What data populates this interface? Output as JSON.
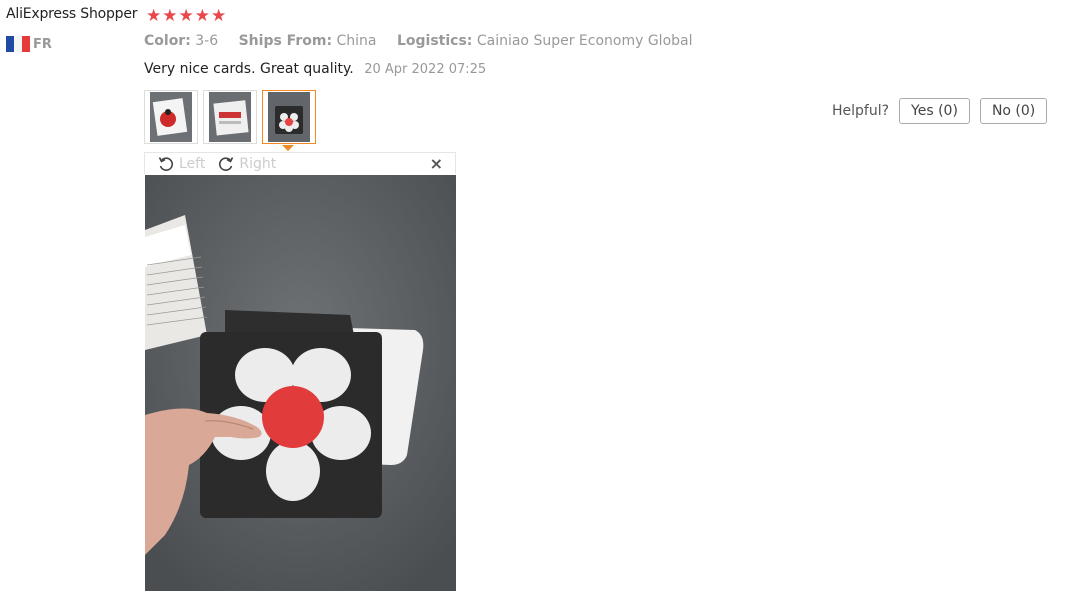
{
  "reviewer": {
    "name": "AliExpress Shopper",
    "rating": 5,
    "country_code": "FR",
    "flag_colors": [
      "#1f4ba5",
      "#ffffff",
      "#e63a3a"
    ]
  },
  "attributes": [
    {
      "key": "Color:",
      "value": "3-6"
    },
    {
      "key": "Ships From:",
      "value": "China"
    },
    {
      "key": "Logistics:",
      "value": "Cainiao Super Economy Global"
    }
  ],
  "review": {
    "text": "Very nice cards. Great quality.",
    "date": "20 Apr 2022 07:25"
  },
  "viewer": {
    "rotate_left": "Left",
    "rotate_right": "Right",
    "close": "×"
  },
  "helpful": {
    "label": "Helpful?",
    "yes": "Yes (0)",
    "no": "No (0)"
  },
  "colors": {
    "star": "#e8484d",
    "active_thumb": "#f08a24"
  }
}
